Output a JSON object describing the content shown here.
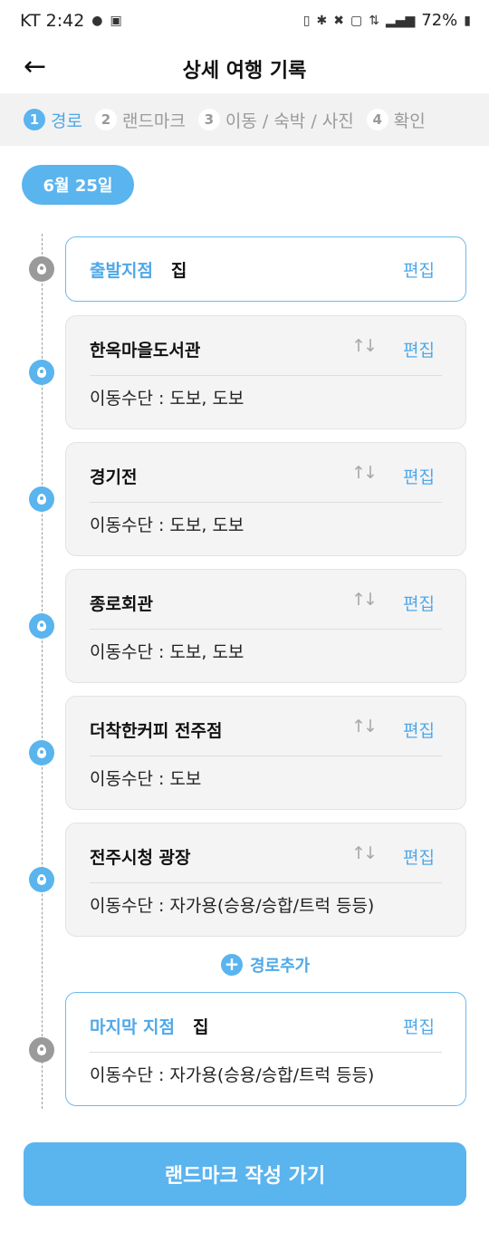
{
  "status_bar": {
    "carrier_time": "KT 2:42",
    "battery": "72%",
    "icons_left": [
      "talk-icon",
      "image-icon"
    ],
    "icons_right": [
      "nfc-icon",
      "bluetooth-icon",
      "mute-icon",
      "hd-icon",
      "5g-icon",
      "signal-icon",
      "battery-icon"
    ]
  },
  "header": {
    "title": "상세 여행 기록"
  },
  "steps": [
    {
      "num": "1",
      "label": "경로",
      "active": true
    },
    {
      "num": "2",
      "label": "랜드마크",
      "active": false
    },
    {
      "num": "3",
      "label": "이동 / 숙박 / 사진",
      "active": false
    },
    {
      "num": "4",
      "label": "확인",
      "active": false
    }
  ],
  "date": "6월 25일",
  "start": {
    "label": "출발지점",
    "place": "집",
    "edit": "편집"
  },
  "stops": [
    {
      "name": "한옥마을도서관",
      "transport": "이동수단 : 도보, 도보",
      "edit": "편집"
    },
    {
      "name": "경기전",
      "transport": "이동수단 : 도보, 도보",
      "edit": "편집"
    },
    {
      "name": "종로회관",
      "transport": "이동수단 : 도보, 도보",
      "edit": "편집"
    },
    {
      "name": "더착한커피 전주점",
      "transport": "이동수단 : 도보",
      "edit": "편집"
    },
    {
      "name": "전주시청 광장",
      "transport": "이동수단 : 자가용(승용/승합/트럭 등등)",
      "edit": "편집"
    }
  ],
  "add_route": "경로추가",
  "end": {
    "label": "마지막 지점",
    "place": "집",
    "transport": "이동수단 : 자가용(승용/승합/트럭 등등)",
    "edit": "편집"
  },
  "cta": "랜드마크 작성 가기",
  "colors": {
    "accent": "#5ab4ee",
    "accent_text": "#4fa8e8",
    "pin_gray": "#9a9a9a",
    "card_gray": "#f4f4f4"
  }
}
